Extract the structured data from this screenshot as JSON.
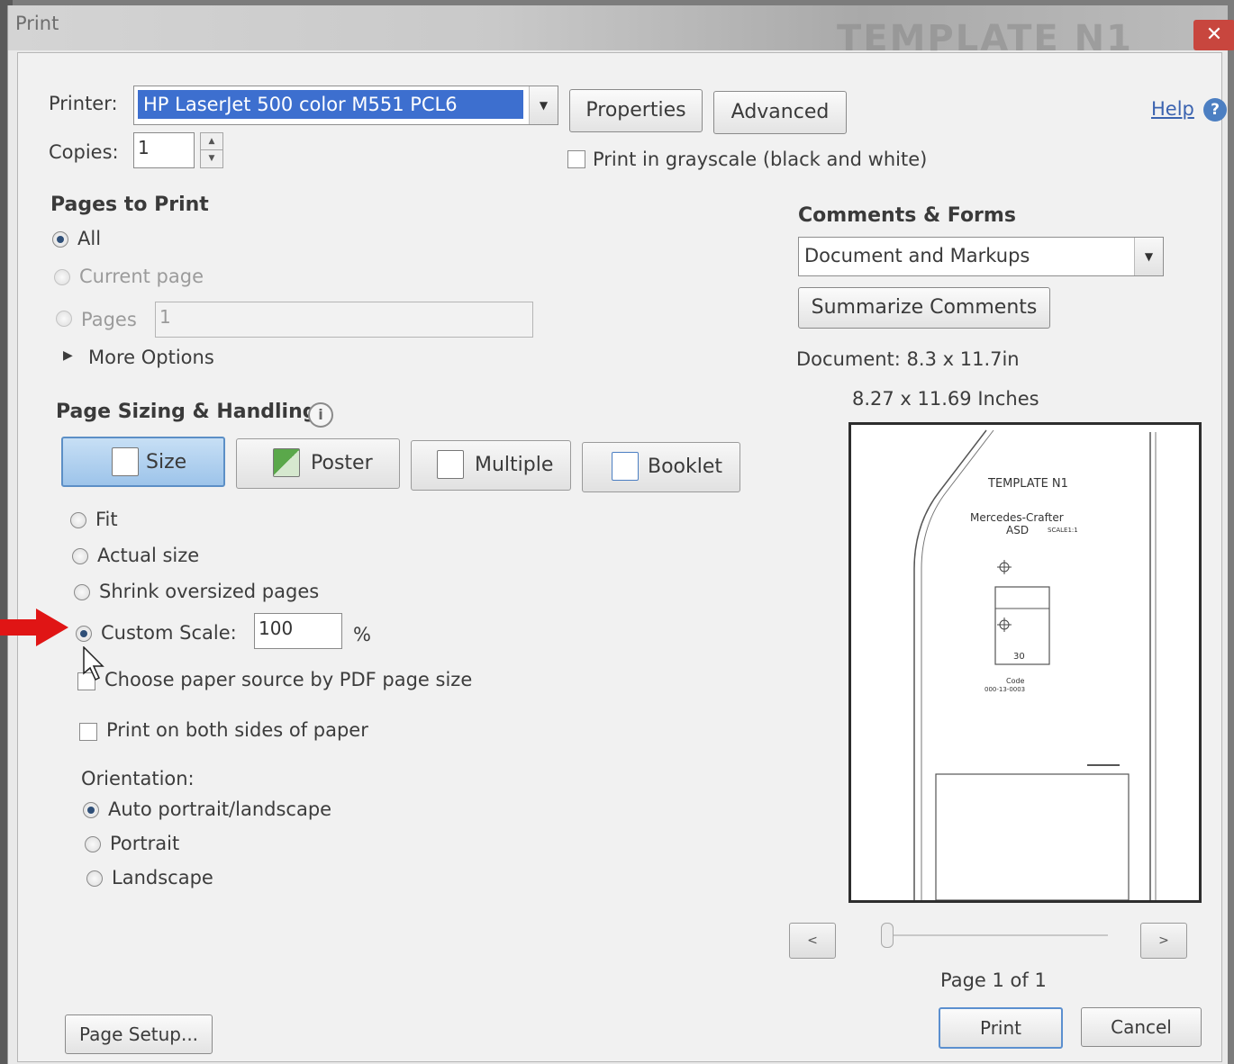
{
  "window": {
    "title": "Print",
    "background_title": "TEMPLATE N1",
    "close_icon": "close-icon"
  },
  "printer": {
    "label": "Printer:",
    "selected": "HP LaserJet 500 color M551 PCL6",
    "properties_button": "Properties",
    "advanced_button": "Advanced",
    "help_link": "Help"
  },
  "copies": {
    "label": "Copies:",
    "value": "1"
  },
  "grayscale": {
    "label": "Print in grayscale (black and white)",
    "checked": false
  },
  "pages_to_print": {
    "title": "Pages to Print",
    "options": {
      "all": "All",
      "current": "Current page",
      "pages": "Pages"
    },
    "selected": "all",
    "pages_value": "1",
    "more_options": "More Options"
  },
  "page_sizing": {
    "title": "Page Sizing & Handling",
    "tabs": {
      "size": "Size",
      "poster": "Poster",
      "multiple": "Multiple",
      "booklet": "Booklet"
    },
    "active_tab": "size",
    "options": {
      "fit": "Fit",
      "actual": "Actual size",
      "shrink": "Shrink oversized pages",
      "custom": "Custom Scale:"
    },
    "selected": "custom",
    "custom_scale_value": "100",
    "percent_sign": "%",
    "paper_source": "Choose paper source by PDF page size",
    "both_sides": "Print on both sides of paper"
  },
  "orientation": {
    "label": "Orientation:",
    "options": {
      "auto": "Auto portrait/landscape",
      "portrait": "Portrait",
      "landscape": "Landscape"
    },
    "selected": "auto"
  },
  "comments_forms": {
    "title": "Comments & Forms",
    "selected": "Document and Markups",
    "summarize_button": "Summarize Comments"
  },
  "document": {
    "size_label": "Document: 8.3 x 11.7in",
    "paper_size": "8.27 x 11.69 Inches"
  },
  "preview": {
    "template": "TEMPLATE N1",
    "model": "Mercedes-Crafter",
    "asd": "ASD",
    "scale": "SCALE1:1",
    "dim": "30",
    "code_label": "Code",
    "code_value": "000-13-0003",
    "page_indicator": "Page 1 of 1",
    "prev": "<",
    "next": ">"
  },
  "footer": {
    "page_setup": "Page Setup...",
    "print": "Print",
    "cancel": "Cancel"
  }
}
